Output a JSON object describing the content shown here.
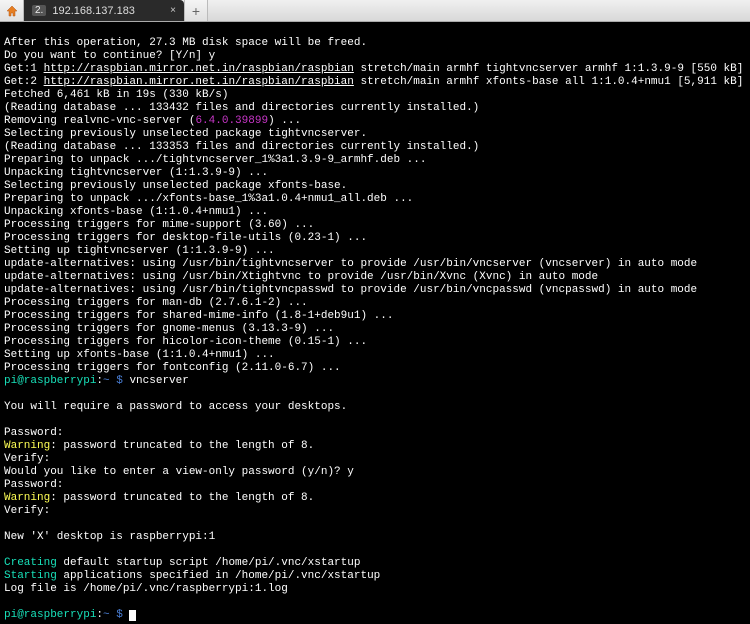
{
  "tab": {
    "num": "2.",
    "title": "192.168.137.183",
    "close": "×",
    "newTab": "+"
  },
  "lines": {
    "l1": "After this operation, 27.3 MB disk space will be freed.",
    "l2": "Do you want to continue? [Y/n] y",
    "l3a": "Get:1 ",
    "l3link": "http://raspbian.mirror.net.in/raspbian/raspbian",
    "l3b": " stretch/main armhf tightvncserver armhf 1:1.3.9-9 [550 kB]",
    "l4a": "Get:2 ",
    "l4link": "http://raspbian.mirror.net.in/raspbian/raspbian",
    "l4b": " stretch/main armhf xfonts-base all 1:1.0.4+nmu1 [5,911 kB]",
    "l5": "Fetched 6,461 kB in 19s (330 kB/s)",
    "l6": "(Reading database ... 133432 files and directories currently installed.)",
    "l7a": "Removing realvnc-vnc-server (",
    "l7b": "6.4.0.39899",
    "l7c": ") ...",
    "l8": "Selecting previously unselected package tightvncserver.",
    "l9": "(Reading database ... 133353 files and directories currently installed.)",
    "l10": "Preparing to unpack .../tightvncserver_1%3a1.3.9-9_armhf.deb ...",
    "l11": "Unpacking tightvncserver (1:1.3.9-9) ...",
    "l12": "Selecting previously unselected package xfonts-base.",
    "l13": "Preparing to unpack .../xfonts-base_1%3a1.0.4+nmu1_all.deb ...",
    "l14": "Unpacking xfonts-base (1:1.0.4+nmu1) ...",
    "l15": "Processing triggers for mime-support (3.60) ...",
    "l16": "Processing triggers for desktop-file-utils (0.23-1) ...",
    "l17": "Setting up tightvncserver (1:1.3.9-9) ...",
    "l18": "update-alternatives: using /usr/bin/tightvncserver to provide /usr/bin/vncserver (vncserver) in auto mode",
    "l19": "update-alternatives: using /usr/bin/Xtightvnc to provide /usr/bin/Xvnc (Xvnc) in auto mode",
    "l20": "update-alternatives: using /usr/bin/tightvncpasswd to provide /usr/bin/vncpasswd (vncpasswd) in auto mode",
    "l21": "Processing triggers for man-db (2.7.6.1-2) ...",
    "l22": "Processing triggers for shared-mime-info (1.8-1+deb9u1) ...",
    "l23": "Processing triggers for gnome-menus (3.13.3-9) ...",
    "l24": "Processing triggers for hicolor-icon-theme (0.15-1) ...",
    "l25": "Setting up xfonts-base (1:1.0.4+nmu1) ...",
    "l26": "Processing triggers for fontconfig (2.11.0-6.7) ...",
    "promptUser": "pi@raspberrypi",
    "promptColon": ":",
    "promptPath": "~ $",
    "cmd1": " vncserver",
    "l28": "You will require a password to access your desktops.",
    "l29": "Password:",
    "warn": "Warning",
    "l30b": ": password truncated to the length of 8.",
    "l31": "Verify:",
    "l32": "Would you like to enter a view-only password (y/n)? y",
    "l33": "Password:",
    "l35": "Verify:",
    "l36": "New 'X' desktop is raspberrypi:1",
    "creating": "Creating",
    "l37b": " default startup script /home/pi/.vnc/xstartup",
    "starting": "Starting",
    "l38b": " applications specified in /home/pi/.vnc/xstartup",
    "l39": "Log file is /home/pi/.vnc/raspberrypi:1.log",
    "cmd2": " "
  }
}
